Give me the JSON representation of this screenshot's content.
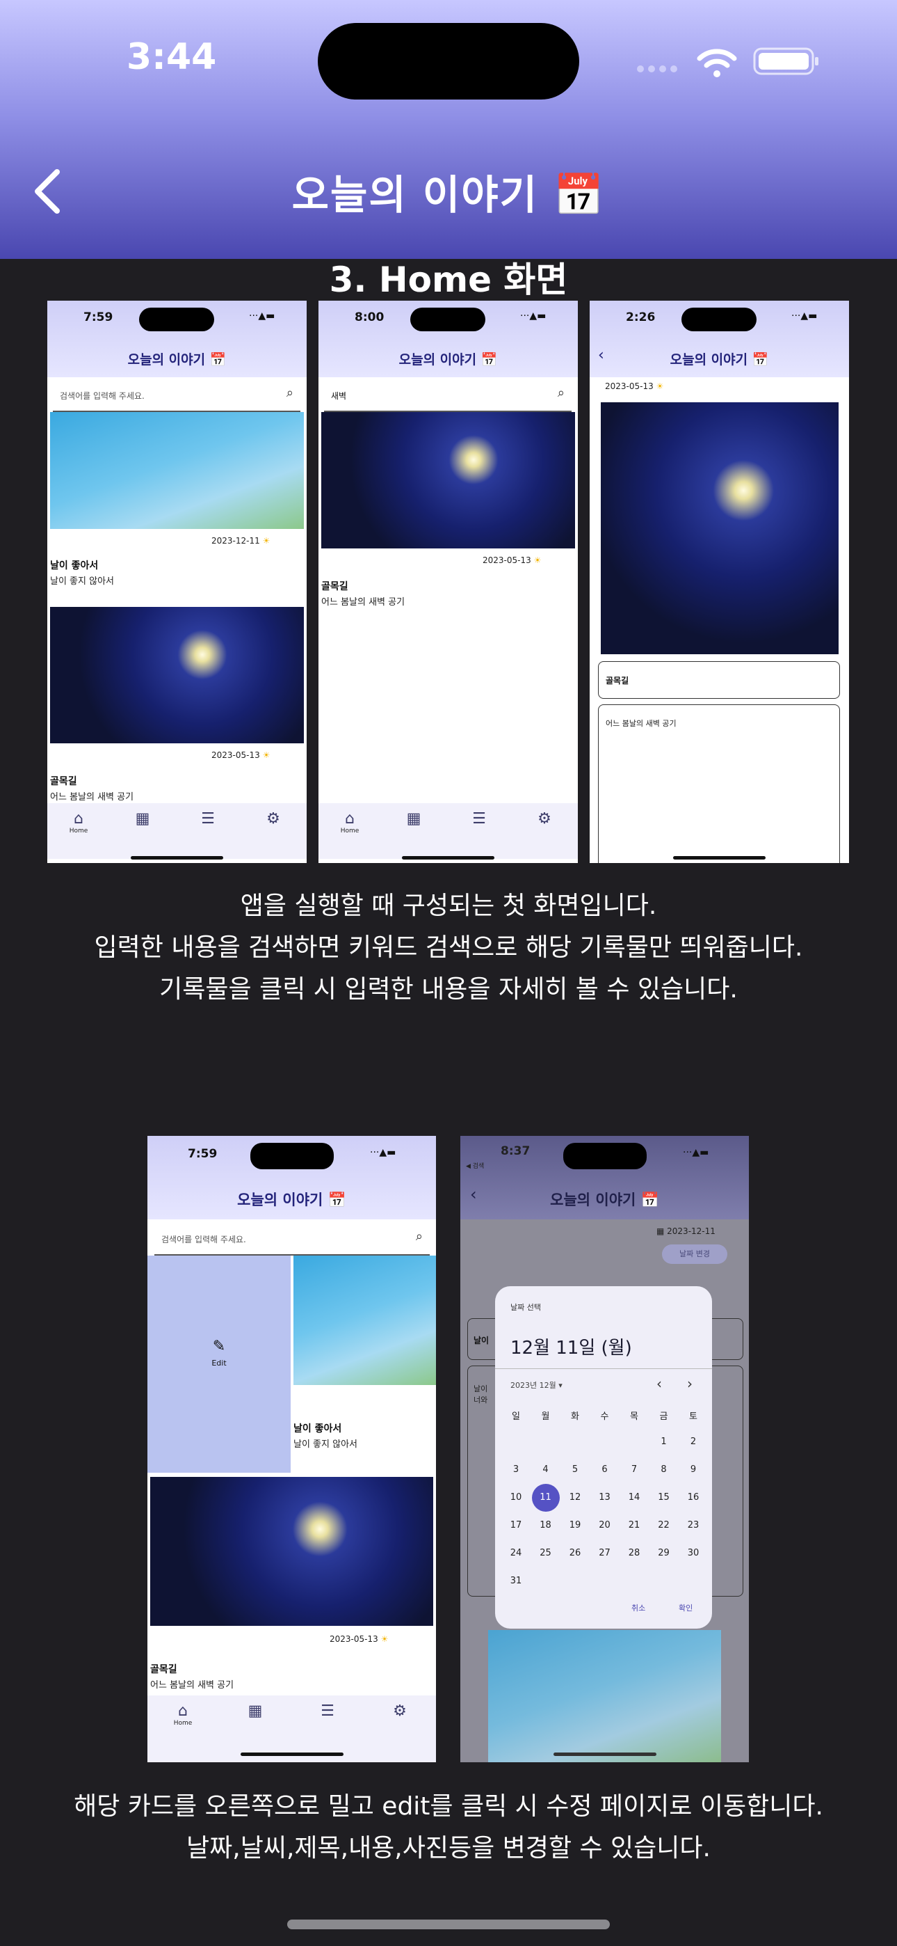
{
  "status_bar": {
    "time": "3:44"
  },
  "app_bar": {
    "title": "오늘의 이야기 📅",
    "back_icon": "chevron-left-icon"
  },
  "section": {
    "heading": "3. Home 화면"
  },
  "screenshots_row1": [
    {
      "time": "7:59",
      "title": "오늘의 이야기 📅",
      "search_placeholder": "검색어를 입력해 주세요.",
      "cards": [
        {
          "date": "2023-12-11",
          "weather": "☀",
          "title": "날이 좋아서",
          "body": "날이 좋지 않아서"
        },
        {
          "date": "2023-05-13",
          "weather": "☀",
          "title": "골목길",
          "body": "어느 봄날의 새벽 공기"
        }
      ],
      "nav_home": "Home"
    },
    {
      "time": "8:00",
      "title": "오늘의 이야기 📅",
      "search_value": "새벽",
      "cards": [
        {
          "date": "2023-05-13",
          "weather": "☀",
          "title": "골목길",
          "body": "어느 봄날의 새벽 공기"
        }
      ],
      "nav_home": "Home"
    },
    {
      "time": "2:26",
      "title": "오늘의 이야기 📅",
      "date": "2023-05-13",
      "weather": "☀",
      "detail_title": "골목길",
      "detail_body": "어느 봄날의 새벽 공기"
    }
  ],
  "description1": [
    "앱을 실행할 때 구성되는 첫 화면입니다.",
    "입력한 내용을 검색하면 키워드 검색으로 해당 기록물만 띄워줍니다.",
    "기록물을 클릭 시 입력한 내용을 자세히 볼 수 있습니다."
  ],
  "screenshots_row2": [
    {
      "time": "7:59",
      "title": "오늘의 이야기 📅",
      "search_placeholder": "검색어를 입력해 주세요.",
      "edit_label": "Edit",
      "cards": [
        {
          "title": "날이 좋아서",
          "body": "날이 좋지 않아서"
        },
        {
          "date": "2023-05-13",
          "weather": "☀",
          "title": "골목길",
          "body": "어느 봄날의 새벽 공기"
        }
      ],
      "nav_home": "Home"
    },
    {
      "time": "8:37",
      "back_label": "◀ 검색",
      "title": "오늘의 이야기 📅",
      "date": "2023-12-11",
      "date_change": "날짜 변경",
      "bg_title_snippet": "날이",
      "bg_body_snippet": "날이 너와",
      "picker": {
        "heading": "날짜 선택",
        "selected": "12월 11일 (월)",
        "month": "2023년 12월",
        "weekdays": [
          "일",
          "월",
          "화",
          "수",
          "목",
          "금",
          "토"
        ],
        "weeks": [
          [
            "",
            "",
            "",
            "",
            "",
            "1",
            "2"
          ],
          [
            "3",
            "4",
            "5",
            "6",
            "7",
            "8",
            "9"
          ],
          [
            "10",
            "11",
            "12",
            "13",
            "14",
            "15",
            "16"
          ],
          [
            "17",
            "18",
            "19",
            "20",
            "21",
            "22",
            "23"
          ],
          [
            "24",
            "25",
            "26",
            "27",
            "28",
            "29",
            "30"
          ],
          [
            "31",
            "",
            "",
            "",
            "",
            "",
            ""
          ]
        ],
        "selected_day": "11",
        "cancel": "취소",
        "confirm": "확인"
      }
    }
  ],
  "description2": [
    "해당 카드를 오른쪽으로 밀고 edit를 클릭 시 수정 페이지로 이동합니다.",
    "날짜,날씨,제목,내용,사진등을 변경할 수 있습니다."
  ],
  "colors": {
    "accent": "#5552c4",
    "app_bar_top": "#c7c7ff",
    "app_bar_bottom": "#4a47b0",
    "background": "#1f1e22"
  }
}
